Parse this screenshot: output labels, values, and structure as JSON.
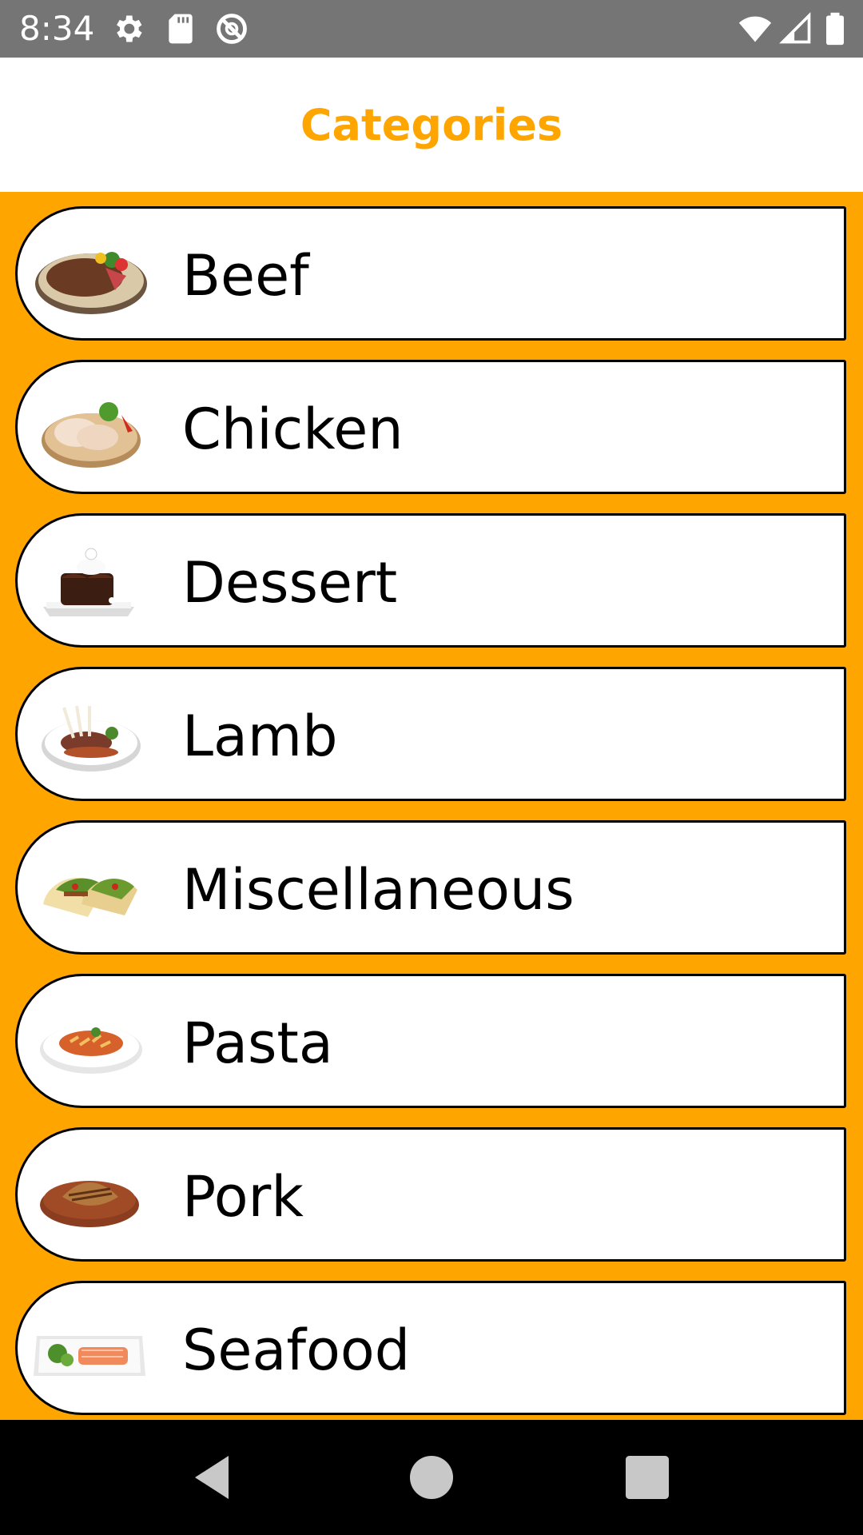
{
  "status_bar": {
    "time": "8:34",
    "left_icons": [
      "gear-icon",
      "sd-card-icon",
      "sync-off-icon"
    ],
    "right_icons": [
      "wifi-icon",
      "signal-icon",
      "battery-icon"
    ]
  },
  "app_bar": {
    "title": "Categories",
    "title_color": "#FFA500"
  },
  "colors": {
    "background": "#FFA500",
    "card": "#FFFFFF",
    "border": "#000000"
  },
  "categories": [
    {
      "label": "Beef",
      "image": "beef-steak-image"
    },
    {
      "label": "Chicken",
      "image": "chicken-legs-image"
    },
    {
      "label": "Dessert",
      "image": "chocolate-cake-image"
    },
    {
      "label": "Lamb",
      "image": "lamb-chops-image"
    },
    {
      "label": "Miscellaneous",
      "image": "tacos-image"
    },
    {
      "label": "Pasta",
      "image": "pasta-plate-image"
    },
    {
      "label": "Pork",
      "image": "pork-chop-image"
    },
    {
      "label": "Seafood",
      "image": "salmon-plate-image"
    }
  ],
  "nav_bar": {
    "buttons": [
      "back-icon",
      "home-icon",
      "recents-icon"
    ]
  }
}
